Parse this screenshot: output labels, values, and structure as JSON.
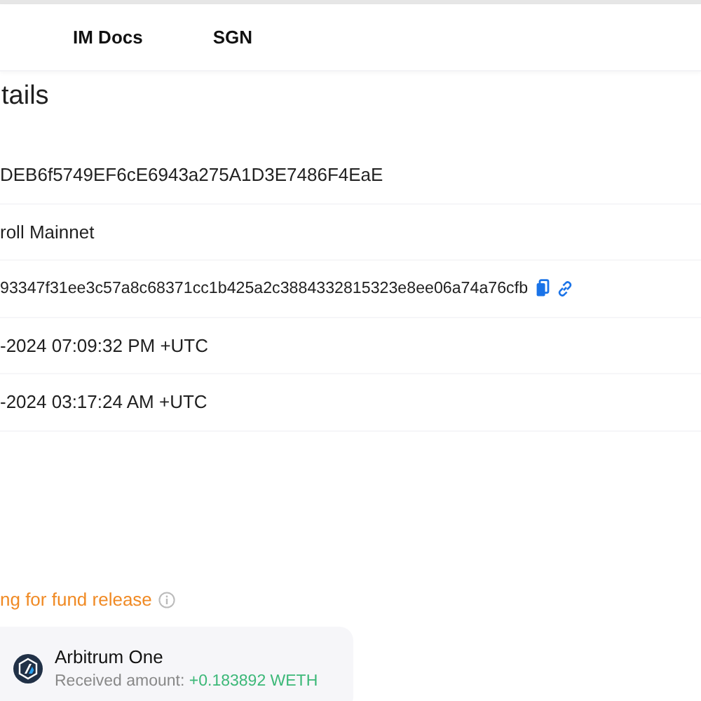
{
  "nav": [
    {
      "label": "IM Docs"
    },
    {
      "label": "SGN"
    }
  ],
  "heading": "tails",
  "rows": [
    {
      "kind": "text",
      "value": "DEB6f5749EF6cE6943a275A1D3E7486F4EaE"
    },
    {
      "kind": "text",
      "value": "roll Mainnet"
    },
    {
      "kind": "hash",
      "value": "93347f31ee3c57a8c68371cc1b425a2c3884332815323e8ee06a74a76cfb"
    },
    {
      "kind": "text",
      "value": "-2024 07:09:32 PM +UTC"
    },
    {
      "kind": "text",
      "value": "-2024 03:17:24 AM +UTC"
    }
  ],
  "status": "ng for fund release",
  "transfer": {
    "chain": "Arbitrum One",
    "label": "Received amount:",
    "amount": "+0.183892 WETH"
  }
}
